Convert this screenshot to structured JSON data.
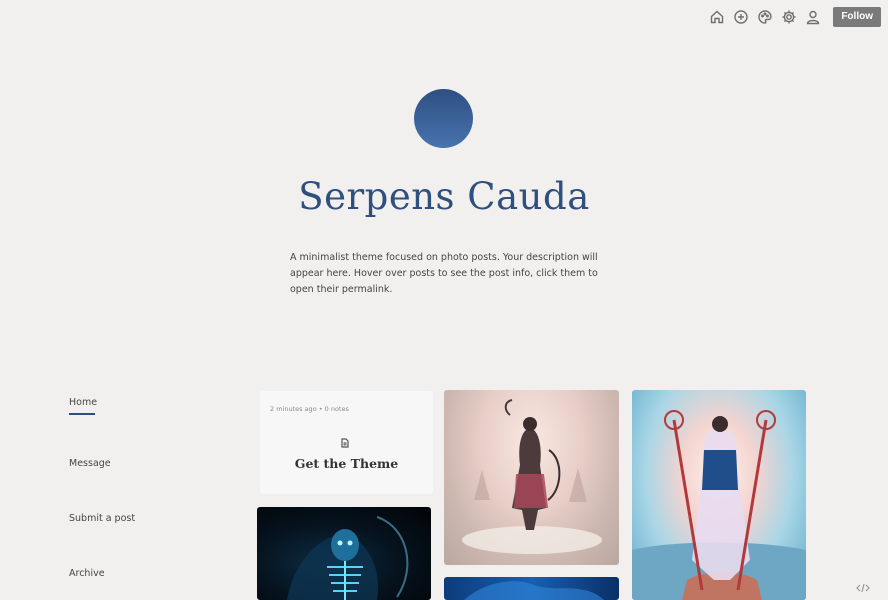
{
  "topbar": {
    "icons": [
      "home-icon",
      "new-post-icon",
      "palette-icon",
      "settings-icon",
      "account-icon"
    ],
    "follow_label": "Follow"
  },
  "header": {
    "title": "Serpens Cauda",
    "description": "A minimalist theme focused on photo posts. Your description will appear here. Hover over posts to see the post info, click them to open their permalink.",
    "accent_color": "#2f4f7e"
  },
  "nav": {
    "items": [
      {
        "label": "Home",
        "active": true
      },
      {
        "label": "Message",
        "active": false
      },
      {
        "label": "Submit a post",
        "active": false
      },
      {
        "label": "Archive",
        "active": false
      }
    ]
  },
  "posts": {
    "text_post": {
      "meta": "2 minutes ago • 0 notes",
      "title": "Get the Theme",
      "icon": "document-icon"
    },
    "photos": [
      "archer-illustration",
      "mage-illustration",
      "skeleton-illustration",
      "blue-illustration"
    ]
  }
}
